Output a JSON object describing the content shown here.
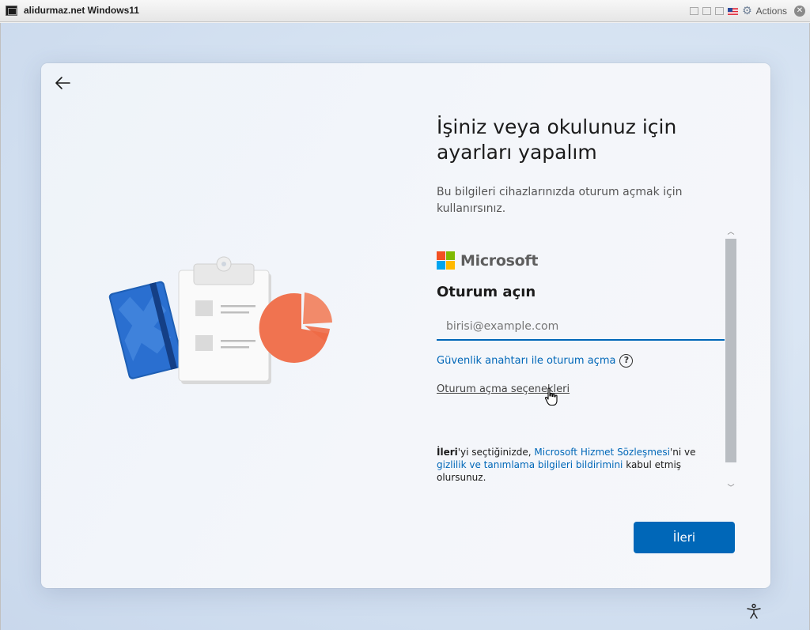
{
  "titlebar": {
    "title": "alidurmaz.net Windows11",
    "actions_label": "Actions"
  },
  "page": {
    "title": "İşiniz veya okulunuz için ayarları yapalım",
    "subtitle": "Bu bilgileri cihazlarınızda oturum açmak için kullanırsınız."
  },
  "signin": {
    "brand": "Microsoft",
    "heading": "Oturum açın",
    "email_value": "",
    "email_placeholder": "birisi@example.com",
    "security_key_link": "Güvenlik anahtarı ile oturum açma",
    "help_glyph": "?",
    "signin_options_link": "Oturum açma seçenekleri"
  },
  "legal": {
    "next_bold": "İleri",
    "text1": "'yi seçtiğinizde, ",
    "link1": "Microsoft Hizmet Sözleşmesi",
    "text2": "'ni ve ",
    "link2": "gizlilik ve tanımlama bilgileri bildirimini",
    "text3": " kabul etmiş olursunuz."
  },
  "buttons": {
    "next_label": "İleri"
  },
  "colors": {
    "accent": "#0067b8",
    "ms_red": "#f25022",
    "ms_green": "#7fba00",
    "ms_blue": "#00a4ef",
    "ms_yellow": "#ffb900"
  },
  "icons": {
    "back": "arrow-left-icon",
    "help": "question-circle-icon",
    "accessibility": "accessibility-icon",
    "scroll_up": "chevron-up-icon",
    "scroll_down": "chevron-down-icon"
  }
}
